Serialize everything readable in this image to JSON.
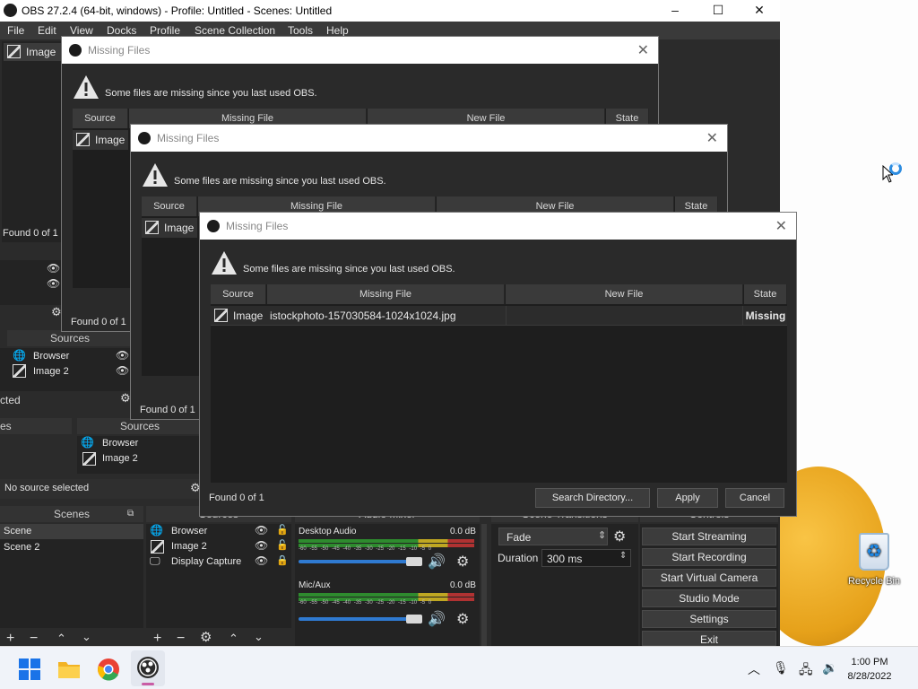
{
  "window": {
    "title": "OBS 27.2.4 (64-bit, windows) - Profile: Untitled - Scenes: Untitled",
    "minimize": "–",
    "maximize": "☐",
    "close": "✕"
  },
  "menu": [
    "File",
    "Edit",
    "View",
    "Docks",
    "Profile",
    "Scene Collection",
    "Tools",
    "Help"
  ],
  "main": {
    "preview_label": "Image",
    "scenes_title": "Scenes",
    "sources_title": "Sources",
    "audio_title": "Audio Mixer",
    "transitions_title": "Scene Transitions",
    "controls_title": "Controls",
    "no_source": "No source selected",
    "scenes": [
      "Scene",
      "Scene 2"
    ],
    "sources": [
      "Browser",
      "Image 2",
      "Display Capture"
    ],
    "partial_label_1": "cted",
    "partial_label_2": "es",
    "partial_found": "Found 0 of 1",
    "audio": {
      "desktop_label": "Desktop Audio",
      "desktop_db": "0.0 dB",
      "mic_label": "Mic/Aux",
      "mic_db": "0.0 dB",
      "scale": "-60 -55 -50 -45 -40 -35 -30 -25 -20 -15 -10 -5 0"
    },
    "transition": {
      "type": "Fade",
      "duration_label": "Duration",
      "duration_value": "300 ms"
    },
    "controls": [
      "Start Streaming",
      "Start Recording",
      "Start Virtual Camera",
      "Studio Mode",
      "Settings",
      "Exit"
    ]
  },
  "dialog": {
    "title": "Missing Files",
    "message": "Some files are missing since you last used OBS.",
    "columns": [
      "Source",
      "Missing File",
      "New File",
      "State"
    ],
    "row": {
      "source": "Image",
      "missing_file": "istockphoto-157030584-1024x1024.jpg",
      "new_file": "",
      "state": "Missing"
    },
    "found": "Found 0 of 1",
    "search_button": "Search Directory...",
    "apply_button": "Apply",
    "cancel_button": "Cancel"
  },
  "desktop": {
    "recycle_bin": "Recycle Bin"
  },
  "taskbar": {
    "time": "1:00 PM",
    "date": "8/28/2022"
  }
}
